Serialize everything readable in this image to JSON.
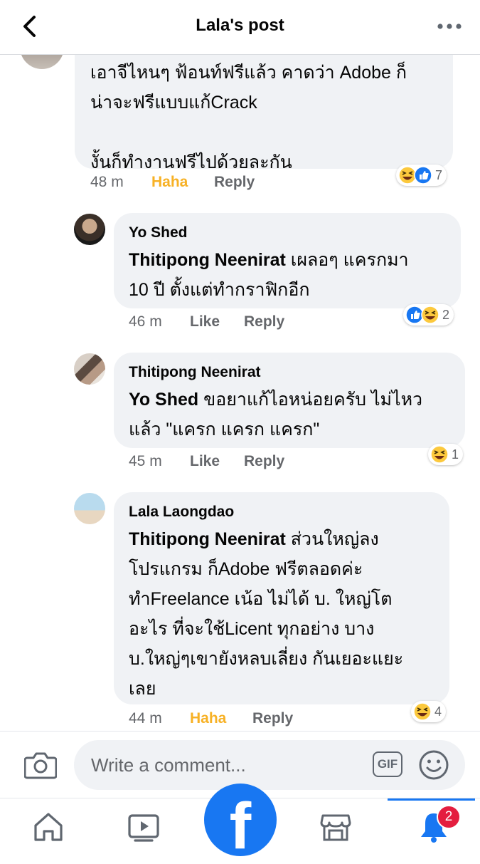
{
  "header": {
    "title": "Lala's post"
  },
  "comments": [
    {
      "text_lines": [
        "เอาจีไหนๆ ฟ้อนท์ฟรีแล้ว คาดว่า Adobe ก็",
        "น่าจะฟรีแบบแก้Crack",
        "",
        "งั้นก็ทำงานฟรีไปด้วยละกัน"
      ],
      "time": "48 m",
      "action": "Haha",
      "reply": "Reply",
      "reaction_count": "7"
    },
    {
      "author": "Yo Shed",
      "mention": "Thitipong Neenirat",
      "text_first": " เผลอๆ แครกมา",
      "text_second": "10 ปี ตั้งแต่ทำกราฟิกอีก",
      "time": "46 m",
      "action": "Like",
      "reply": "Reply",
      "reaction_count": "2"
    },
    {
      "author": "Thitipong Neenirat",
      "mention": "Yo Shed",
      "text_first": " ขอยาแก้ไอหน่อยครับ ไม่ไหว",
      "text_second": "แล้ว \"แครก แครก แครก\"",
      "time": "45 m",
      "action": "Like",
      "reply": "Reply",
      "reaction_count": "1"
    },
    {
      "author": "Lala Laongdao",
      "mention": "Thitipong Neenirat",
      "text_first": " ส่วนใหญ่ลง",
      "text_lines": [
        "โปรแกรม ก็Adobe ฟรีตลอดค่ะ",
        "ทำFreelance เน้อ ไม่ได้ บ. ใหญ่โต",
        "อะไร ที่จะใช้Licent ทุกอย่าง บาง",
        "บ.ใหญ่ๆเขายังหลบเลี่ยง กันเยอะแยะ",
        "เลย"
      ],
      "time": "44 m",
      "action": "Haha",
      "reply": "Reply",
      "reaction_count": "4"
    }
  ],
  "composer": {
    "placeholder": "Write a comment...",
    "gif_label": "GIF"
  },
  "tabbar": {
    "notification_badge": "2",
    "center_logo": "f"
  },
  "colors": {
    "accent": "#1877f2",
    "haha": "#f7b125",
    "bubble": "#f0f2f5",
    "badge": "#e41e3f"
  },
  "icons": [
    "back-icon",
    "more-icon",
    "camera-icon",
    "gif-icon",
    "emoji-icon",
    "home-icon",
    "video-icon",
    "facebook-icon",
    "marketplace-icon",
    "bell-icon",
    "haha-reaction-icon",
    "like-reaction-icon"
  ]
}
